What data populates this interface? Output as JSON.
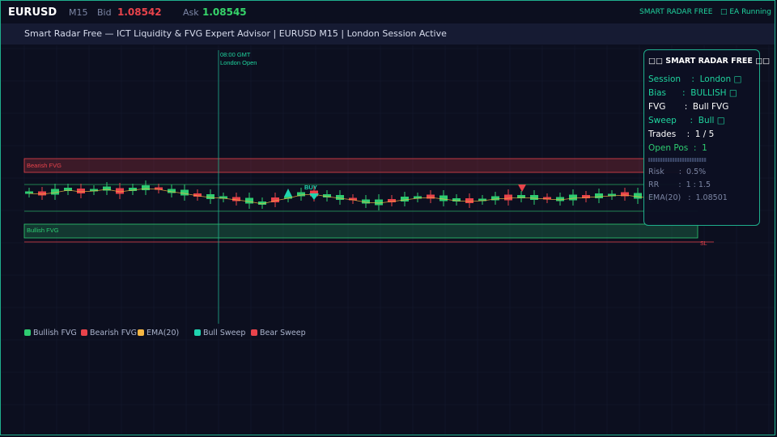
{
  "topbar": {
    "symbol": "EURUSD",
    "timeframe": "M15",
    "bid_label": "Bid",
    "bid_value": "1.08542",
    "ask_label": "Ask",
    "ask_value": "1.08545",
    "brand": "SMART RADAR  FREE",
    "ea_status": "□ EA Running"
  },
  "titlebar": {
    "text": "Smart Radar Free  —  ICT Liquidity & FVG Expert Advisor  |  EURUSD  M15  |  London Session Active"
  },
  "chart": {
    "session_time": "08:00 GMT",
    "session_label": "London Open",
    "bearish_fvg_label": "Bearish FVG",
    "bullish_fvg_label": "Bullish FVG",
    "buy_label": "BUY",
    "sl_label": "SL",
    "colors": {
      "bull": "#2ecc71",
      "bear": "#e8434b",
      "ema": "#f5b642",
      "sweep_bull": "#1fd4b0",
      "sweep_bear": "#e8434b",
      "accent": "#1fd49e"
    }
  },
  "panel": {
    "title": "□□ SMART RADAR FREE □□",
    "session": "Session    :  London □",
    "bias": "Bias      :  BULLISH □",
    "fvg": "FVG       :  Bull FVG",
    "sweep": "Sweep     :  Bull □",
    "trades": "Trades    :  1 / 5",
    "open_pos": "Open Pos  :  1",
    "risk": "Risk      :  0.5%",
    "rr": "RR        :  1 : 1.5",
    "ema": "EMA(20)   :  1.08501"
  },
  "legend": {
    "bullish_fvg": "Bullish FVG",
    "bearish_fvg": "Bearish FVG",
    "ema": "EMA(20)",
    "bull_sweep": "Bull Sweep",
    "bear_sweep": "Bear Sweep"
  }
}
